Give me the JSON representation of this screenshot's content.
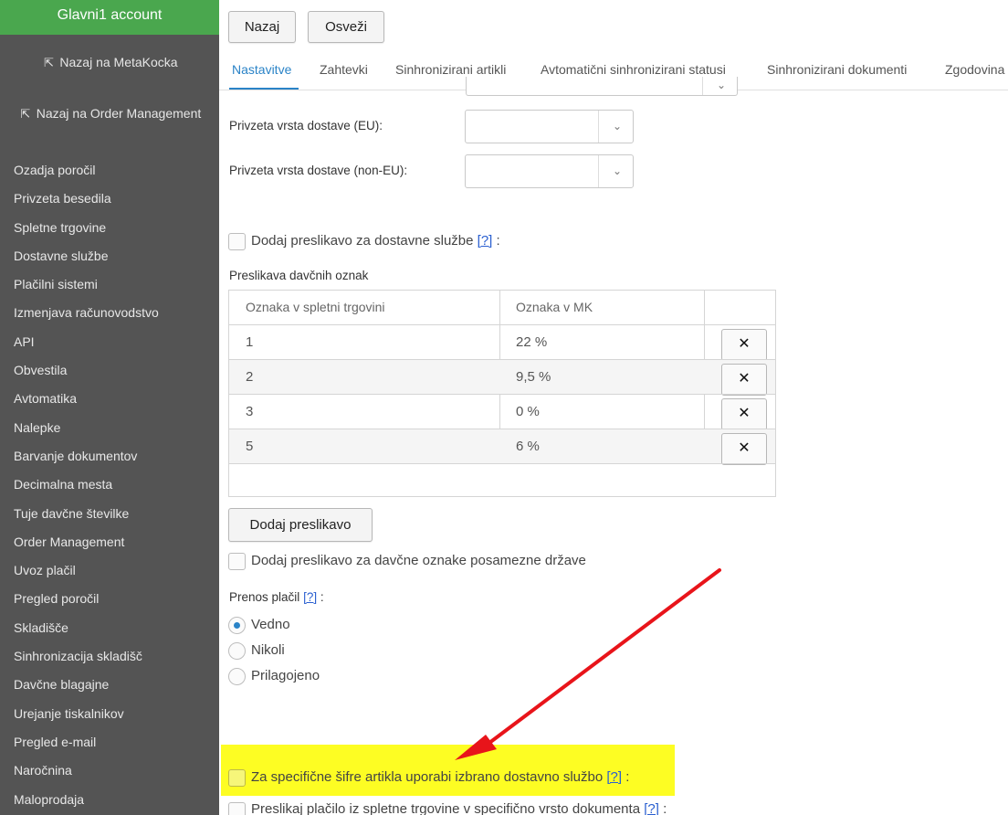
{
  "sidebar": {
    "account": "Glavni1 account",
    "back_metakocka": "Nazaj na MetaKocka",
    "back_order_mgmt": "Nazaj na Order Management",
    "items": [
      "Ozadja poročil",
      "Privzeta besedila",
      "Spletne trgovine",
      "Dostavne službe",
      "Plačilni sistemi",
      "Izmenjava računovodstvo",
      "API",
      "Obvestila",
      "Avtomatika",
      "Nalepke",
      "Barvanje dokumentov",
      "Decimalna mesta",
      "Tuje davčne številke",
      "Order Management",
      "Uvoz plačil",
      "Pregled poročil",
      "Skladišče",
      "Sinhronizacija skladišč",
      "Davčne blagajne",
      "Urejanje tiskalnikov",
      "Pregled e-mail",
      "Naročnina",
      "Maloprodaja"
    ],
    "colors": {
      "background": "#545454",
      "account_bg": "#4aa74e"
    }
  },
  "toolbar": {
    "back": "Nazaj",
    "refresh": "Osveži"
  },
  "tabs": [
    "Nastavitve",
    "Zahtevki",
    "Sinhronizirani artikli",
    "Avtomatični sinhronizirani statusi",
    "Sinhronizirani dokumenti",
    "Zgodovina"
  ],
  "active_tab": "Nastavitve",
  "form": {
    "delivery_eu_label": "Privzeta vrsta dostave (EU):",
    "delivery_non_eu_label": "Privzeta vrsta dostave (non-EU):",
    "delivery_map_label": "Dodaj preslikavo za dostavne službe",
    "help": "[?]",
    "colon": ":",
    "tax_map_title": "Preslikava davčnih oznak",
    "tax_table": {
      "headers": [
        "Oznaka v spletni trgovini",
        "Oznaka v MK"
      ],
      "rows": [
        {
          "shop": "1",
          "mk": "22 %"
        },
        {
          "shop": "2",
          "mk": "9,5 %"
        },
        {
          "shop": "3",
          "mk": "0 %"
        },
        {
          "shop": "5",
          "mk": "6 %"
        }
      ],
      "delete_symbol": "✕"
    },
    "add_map_button": "Dodaj preslikavo",
    "country_tax_map_label": "Dodaj preslikavo za davčne oznake posamezne države",
    "payment_transfer_label": "Prenos plačil",
    "payment_options": [
      "Vedno",
      "Nikoli",
      "Prilagojeno"
    ],
    "payment_selected": "Vedno",
    "specific_sku_label": "Za specifične šifre artikla uporabi izbrano dostavno službo",
    "map_payment_label": "Preslikaj plačilo iz spletne trgovine v specifično vrsto dokumenta"
  },
  "colors": {
    "accent": "#2a83c7",
    "highlight": "#fdfd23",
    "arrow": "#e8141a"
  }
}
